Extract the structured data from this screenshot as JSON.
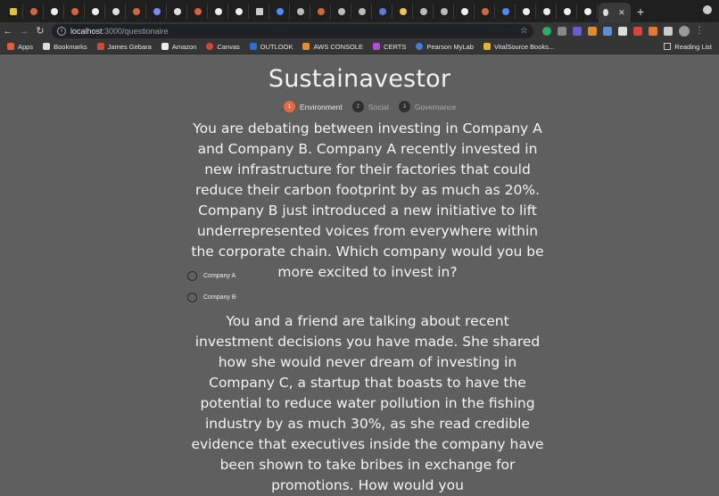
{
  "browser": {
    "address_host": "localhost",
    "address_path": ":3000/questionaire",
    "bookmarks": [
      {
        "label": "Apps",
        "icon": "apps-grid-icon"
      },
      {
        "label": "Bookmarks",
        "icon": "star-icon"
      },
      {
        "label": "James Gebara",
        "icon": "bookmark-icon"
      },
      {
        "label": "Amazon",
        "icon": "amazon-icon"
      },
      {
        "label": "Canvas",
        "icon": "canvas-icon"
      },
      {
        "label": "OUTLOOK",
        "icon": "outlook-icon"
      },
      {
        "label": "AWS CONSOLE",
        "icon": "aws-icon"
      },
      {
        "label": "CERTS",
        "icon": "certs-icon"
      },
      {
        "label": "Pearson MyLab",
        "icon": "pearson-icon"
      },
      {
        "label": "VitalSource Books...",
        "icon": "vitalsource-icon"
      }
    ],
    "reading_list": "Reading List"
  },
  "app": {
    "title": "Sustainavestor",
    "steps": [
      {
        "num": "1",
        "label": "Environment",
        "state": "active"
      },
      {
        "num": "2",
        "label": "Social",
        "state": "inactive"
      },
      {
        "num": "3",
        "label": "Governance",
        "state": "inactive"
      }
    ],
    "questions": [
      {
        "text": "You are debating between investing in Company A and Company B. Company A recently invested in new infrastructure for their factories that could reduce their carbon footprint by as much as 20%. Company B just introduced a new initiative to lift underrepresented voices from everywhere within the corporate chain. Which company would you be more excited to invest in?",
        "options": [
          "Company A",
          "Company B"
        ]
      },
      {
        "text": "You and a friend are talking about recent investment decisions you have made. She shared how she would never dream of investing in Company C, a startup that boasts to have the potential to reduce water pollution in the fishing industry by as much 30%, as she read credible evidence that executives inside the company have been shown to take bribes in exchange for promotions. How would you"
      }
    ]
  },
  "colors": {
    "page_bg": "#5f5f5f",
    "step_active": "#e8693a",
    "step_inactive": "#2e2e2e"
  }
}
